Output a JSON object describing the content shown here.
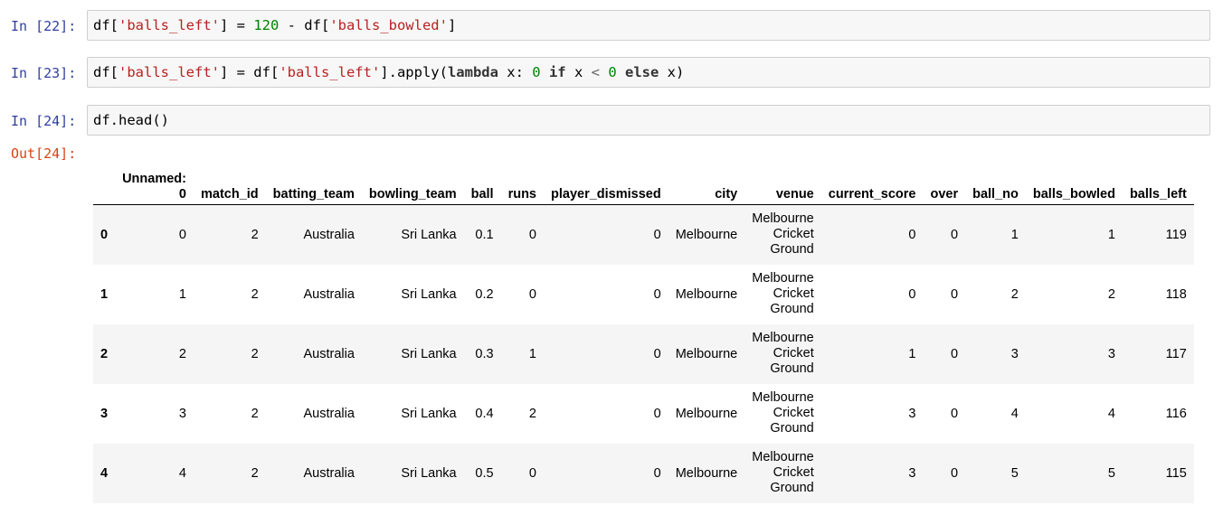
{
  "cells": [
    {
      "prompt": "In [22]:",
      "code": [
        "df[",
        "'balls_left'",
        "] = ",
        "120",
        " - df[",
        "'balls_bowled'",
        "]"
      ]
    },
    {
      "prompt": "In [23]:",
      "code": [
        "df[",
        "'balls_left'",
        "] = df[",
        "'balls_left'",
        "].apply(",
        "lambda",
        " x: ",
        "0",
        " ",
        "if",
        " x ",
        "<",
        " ",
        "0",
        " ",
        "else",
        " x)"
      ]
    },
    {
      "prompt": "In [24]:",
      "code": [
        "df.head()"
      ]
    }
  ],
  "output": {
    "prompt": "Out[24]:",
    "columns": [
      "Unnamed:",
      "0",
      "match_id",
      "batting_team",
      "bowling_team",
      "ball",
      "runs",
      "player_dismissed",
      "city",
      "venue",
      "current_score",
      "over",
      "ball_no",
      "balls_bowled",
      "balls_left"
    ],
    "rows": [
      {
        "index": "0",
        "unnamed": "0",
        "match_id": "2",
        "batting_team": "Australia",
        "bowling_team": "Sri Lanka",
        "ball": "0.1",
        "runs": "0",
        "player_dismissed": "0",
        "city": "Melbourne",
        "venue": [
          "Melbourne",
          "Cricket",
          "Ground"
        ],
        "current_score": "0",
        "over": "0",
        "ball_no": "1",
        "balls_bowled": "1",
        "balls_left": "119"
      },
      {
        "index": "1",
        "unnamed": "1",
        "match_id": "2",
        "batting_team": "Australia",
        "bowling_team": "Sri Lanka",
        "ball": "0.2",
        "runs": "0",
        "player_dismissed": "0",
        "city": "Melbourne",
        "venue": [
          "Melbourne",
          "Cricket",
          "Ground"
        ],
        "current_score": "0",
        "over": "0",
        "ball_no": "2",
        "balls_bowled": "2",
        "balls_left": "118"
      },
      {
        "index": "2",
        "unnamed": "2",
        "match_id": "2",
        "batting_team": "Australia",
        "bowling_team": "Sri Lanka",
        "ball": "0.3",
        "runs": "1",
        "player_dismissed": "0",
        "city": "Melbourne",
        "venue": [
          "Melbourne",
          "Cricket",
          "Ground"
        ],
        "current_score": "1",
        "over": "0",
        "ball_no": "3",
        "balls_bowled": "3",
        "balls_left": "117"
      },
      {
        "index": "3",
        "unnamed": "3",
        "match_id": "2",
        "batting_team": "Australia",
        "bowling_team": "Sri Lanka",
        "ball": "0.4",
        "runs": "2",
        "player_dismissed": "0",
        "city": "Melbourne",
        "venue": [
          "Melbourne",
          "Cricket",
          "Ground"
        ],
        "current_score": "3",
        "over": "0",
        "ball_no": "4",
        "balls_bowled": "4",
        "balls_left": "116"
      },
      {
        "index": "4",
        "unnamed": "4",
        "match_id": "2",
        "batting_team": "Australia",
        "bowling_team": "Sri Lanka",
        "ball": "0.5",
        "runs": "0",
        "player_dismissed": "0",
        "city": "Melbourne",
        "venue": [
          "Melbourne",
          "Cricket",
          "Ground"
        ],
        "current_score": "3",
        "over": "0",
        "ball_no": "5",
        "balls_bowled": "5",
        "balls_left": "115"
      }
    ]
  }
}
